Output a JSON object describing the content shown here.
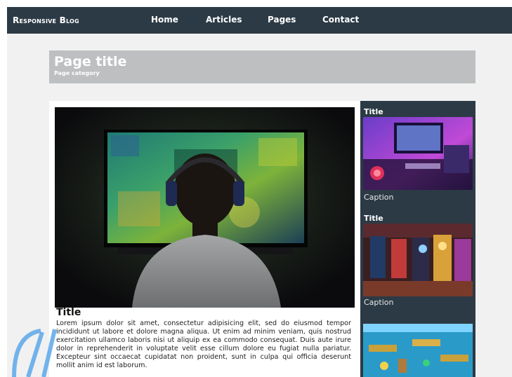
{
  "nav": {
    "brand": "Responsive Blog",
    "links": [
      "Home",
      "Articles",
      "Pages",
      "Contact"
    ]
  },
  "header": {
    "title": "Page title",
    "category": "Page category"
  },
  "article": {
    "title": "Title",
    "body": "Lorem ipsum dolor sit amet, consectetur adipisicing elit, sed do eiusmod tempor incididunt ut labore et dolore magna aliqua. Ut enim ad minim veniam, quis nostrud exercitation ullamco laboris nisi ut aliquip ex ea commodo consequat. Duis aute irure dolor in reprehenderit in voluptate velit esse cillum dolore eu fugiat nulla pariatur. Excepteur sint occaecat cupidatat non proident, sunt in culpa qui officia deserunt mollit anim id est laborum."
  },
  "sidebar": {
    "items": [
      {
        "title": "Title",
        "caption": "Caption"
      },
      {
        "title": "Title",
        "caption": "Caption"
      }
    ]
  },
  "colors": {
    "nav_bg": "#2c3a45",
    "banner_bg": "#bdbfc1",
    "page_bg": "#f1f1f1"
  }
}
